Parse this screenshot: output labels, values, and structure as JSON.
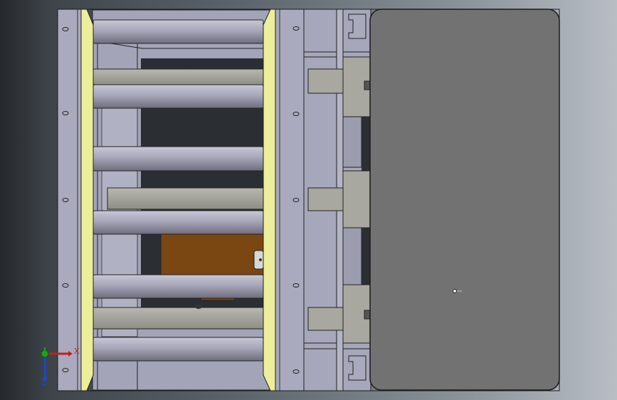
{
  "viewport": {
    "background_colors": [
      "#25282c",
      "#5d656d",
      "#b8bec4"
    ],
    "model": {
      "frame_color": "#a9aabd",
      "roller_color": "#9a9aab",
      "liner_color": "#ecee9c",
      "plate_color": "#727272",
      "bracket_color": "#7a4712",
      "grey_part_color": "#a8a8a0"
    }
  },
  "triad": {
    "x_label": "X",
    "y_label": "Y",
    "z_label": "Z",
    "x_color": "#c41f1f",
    "y_color": "#1ea01e",
    "z_color": "#2244cc"
  }
}
